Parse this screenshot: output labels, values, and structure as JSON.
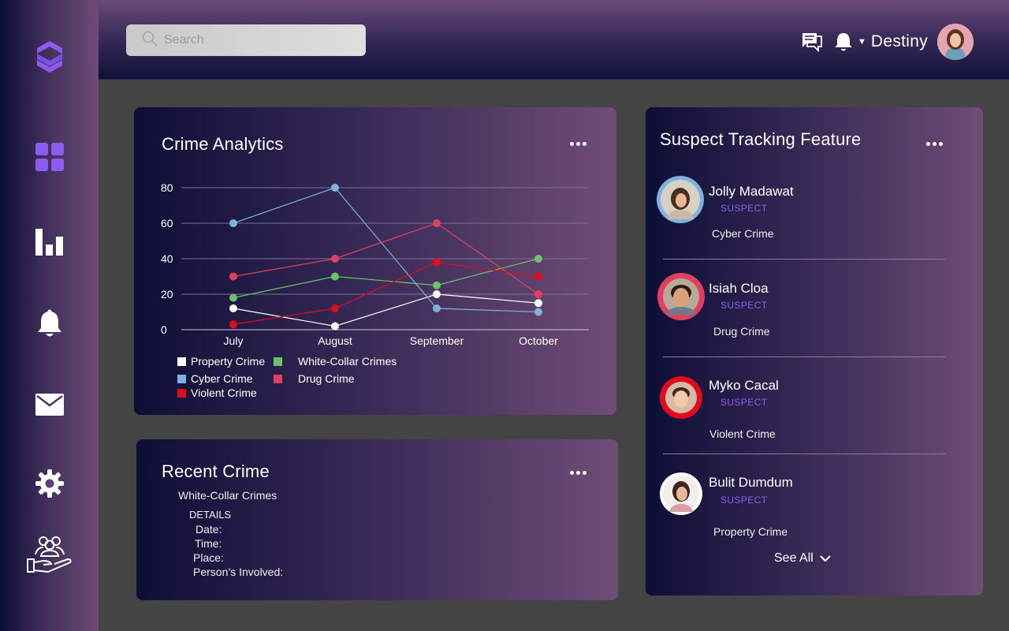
{
  "topbar": {
    "search_placeholder": "Search",
    "username": "Destiny",
    "icons": [
      "chat-icon",
      "bell-icon",
      "caret-down-icon"
    ]
  },
  "sidebar": {
    "items": [
      {
        "icon": "logo-icon"
      },
      {
        "icon": "dashboard-grid-icon"
      },
      {
        "icon": "bar-chart-icon"
      },
      {
        "icon": "bell-icon"
      },
      {
        "icon": "mail-icon"
      },
      {
        "icon": "gear-icon"
      },
      {
        "icon": "people-hand-icon"
      }
    ],
    "accent": "#8c5cf0"
  },
  "analytics": {
    "title": "Crime Analytics",
    "legend": [
      "Property Crime",
      "White-Collar Crimes",
      "Cyber Crime",
      "Drug Crime",
      "Violent Crime"
    ]
  },
  "chart_data": {
    "type": "line",
    "title": "Crime Analytics",
    "xlabel": "",
    "ylabel": "",
    "x": [
      "July",
      "August",
      "September",
      "October"
    ],
    "ylim": [
      0,
      80
    ],
    "yticks": [
      0,
      20,
      40,
      60,
      80
    ],
    "grid": true,
    "legend_position": "bottom-left",
    "series": [
      {
        "name": "Property Crime",
        "color": "#ffffff",
        "values": [
          12,
          2,
          20,
          15
        ]
      },
      {
        "name": "White-Collar Crimes",
        "color": "#6ec26e",
        "values": [
          18,
          30,
          25,
          40
        ]
      },
      {
        "name": "Cyber Crime",
        "color": "#7fb0e0",
        "values": [
          60,
          80,
          12,
          10
        ]
      },
      {
        "name": "Drug Crime",
        "color": "#e0405f",
        "values": [
          30,
          40,
          60,
          20
        ]
      },
      {
        "name": "Violent Crime",
        "color": "#e00b1c",
        "values": [
          3,
          12,
          38,
          30
        ]
      }
    ]
  },
  "recent": {
    "title": "Recent Crime",
    "category": "White-Collar Crimes",
    "details_label": "DETAILS",
    "date_label": "Date:",
    "time_label": "Time:",
    "place_label": "Place:",
    "persons_label": "Person’s Involved:"
  },
  "suspects": {
    "title": "Suspect Tracking Feature",
    "see_all": "See All",
    "items": [
      {
        "name": "Jolly Madawat",
        "tag": "SUSPECT",
        "crime": "Cyber Crime",
        "ring": "#7fb0e0"
      },
      {
        "name": "Isiah Cloa",
        "tag": "SUSPECT",
        "crime": "Drug Crime",
        "ring": "#e0405f"
      },
      {
        "name": "Myko Cacal",
        "tag": "SUSPECT",
        "crime": "Violent Crime",
        "ring": "#e00b1c"
      },
      {
        "name": "Bulit Dumdum",
        "tag": "SUSPECT",
        "crime": "Property Crime",
        "ring": "#ffffff"
      }
    ]
  }
}
